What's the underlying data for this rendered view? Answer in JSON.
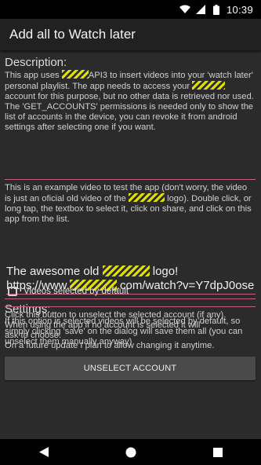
{
  "status_bar": {
    "time": "10:39",
    "icons": [
      "wifi-icon",
      "signal-icon",
      "battery-icon"
    ]
  },
  "app_bar": {
    "title": "Add all to Watch later"
  },
  "description": {
    "title": "Description:",
    "p1_a": "This app uses",
    "p1_b": "API3 to insert videos into your 'watch later' personal playlist. The app needs to access your",
    "p1_c": "account for this purpose, but no other data is retrieved nor used. The 'GET_ACCOUNTS' permissions is needed only to show the list of accounts in the device, you can revoke it from android settings after selecting one if you want.",
    "p2_a": "This is an example video to test the app (don't worry, the video is just an oficial old video of the",
    "p2_b": "logo). Double click, or long tap, the textbox to select it, click on share, and click on this app from the list."
  },
  "example_text": {
    "line1_a": "The awesome old",
    "line1_b": "logo!",
    "line2_a": "https://www.",
    "line2_b": ".com/watch?v=Y7dpJ0oseIA"
  },
  "settings": {
    "title": "Settings:",
    "text": "If this option is selected videos will be selected by default, so simply clicking 'save' on the dialog will save them all (you can unselect them manually anyway)",
    "checkbox_label": "Videos selected by default",
    "checkbox_checked": false
  },
  "account": {
    "text1": "Click this button to unselect the selected account (if any).",
    "text2": "When using the app if no account is selected it will",
    "text3": "ask to choose.",
    "text4": "On a future update I plan to allow changing it anytime.",
    "button_label": "UNSELECT ACCOUNT"
  },
  "nav_bar": {
    "buttons": [
      "back-icon",
      "home-icon",
      "recents-icon"
    ]
  },
  "colors": {
    "accent": "#c0607a",
    "background": "#2b2b2b",
    "redaction": "#e0e000"
  }
}
